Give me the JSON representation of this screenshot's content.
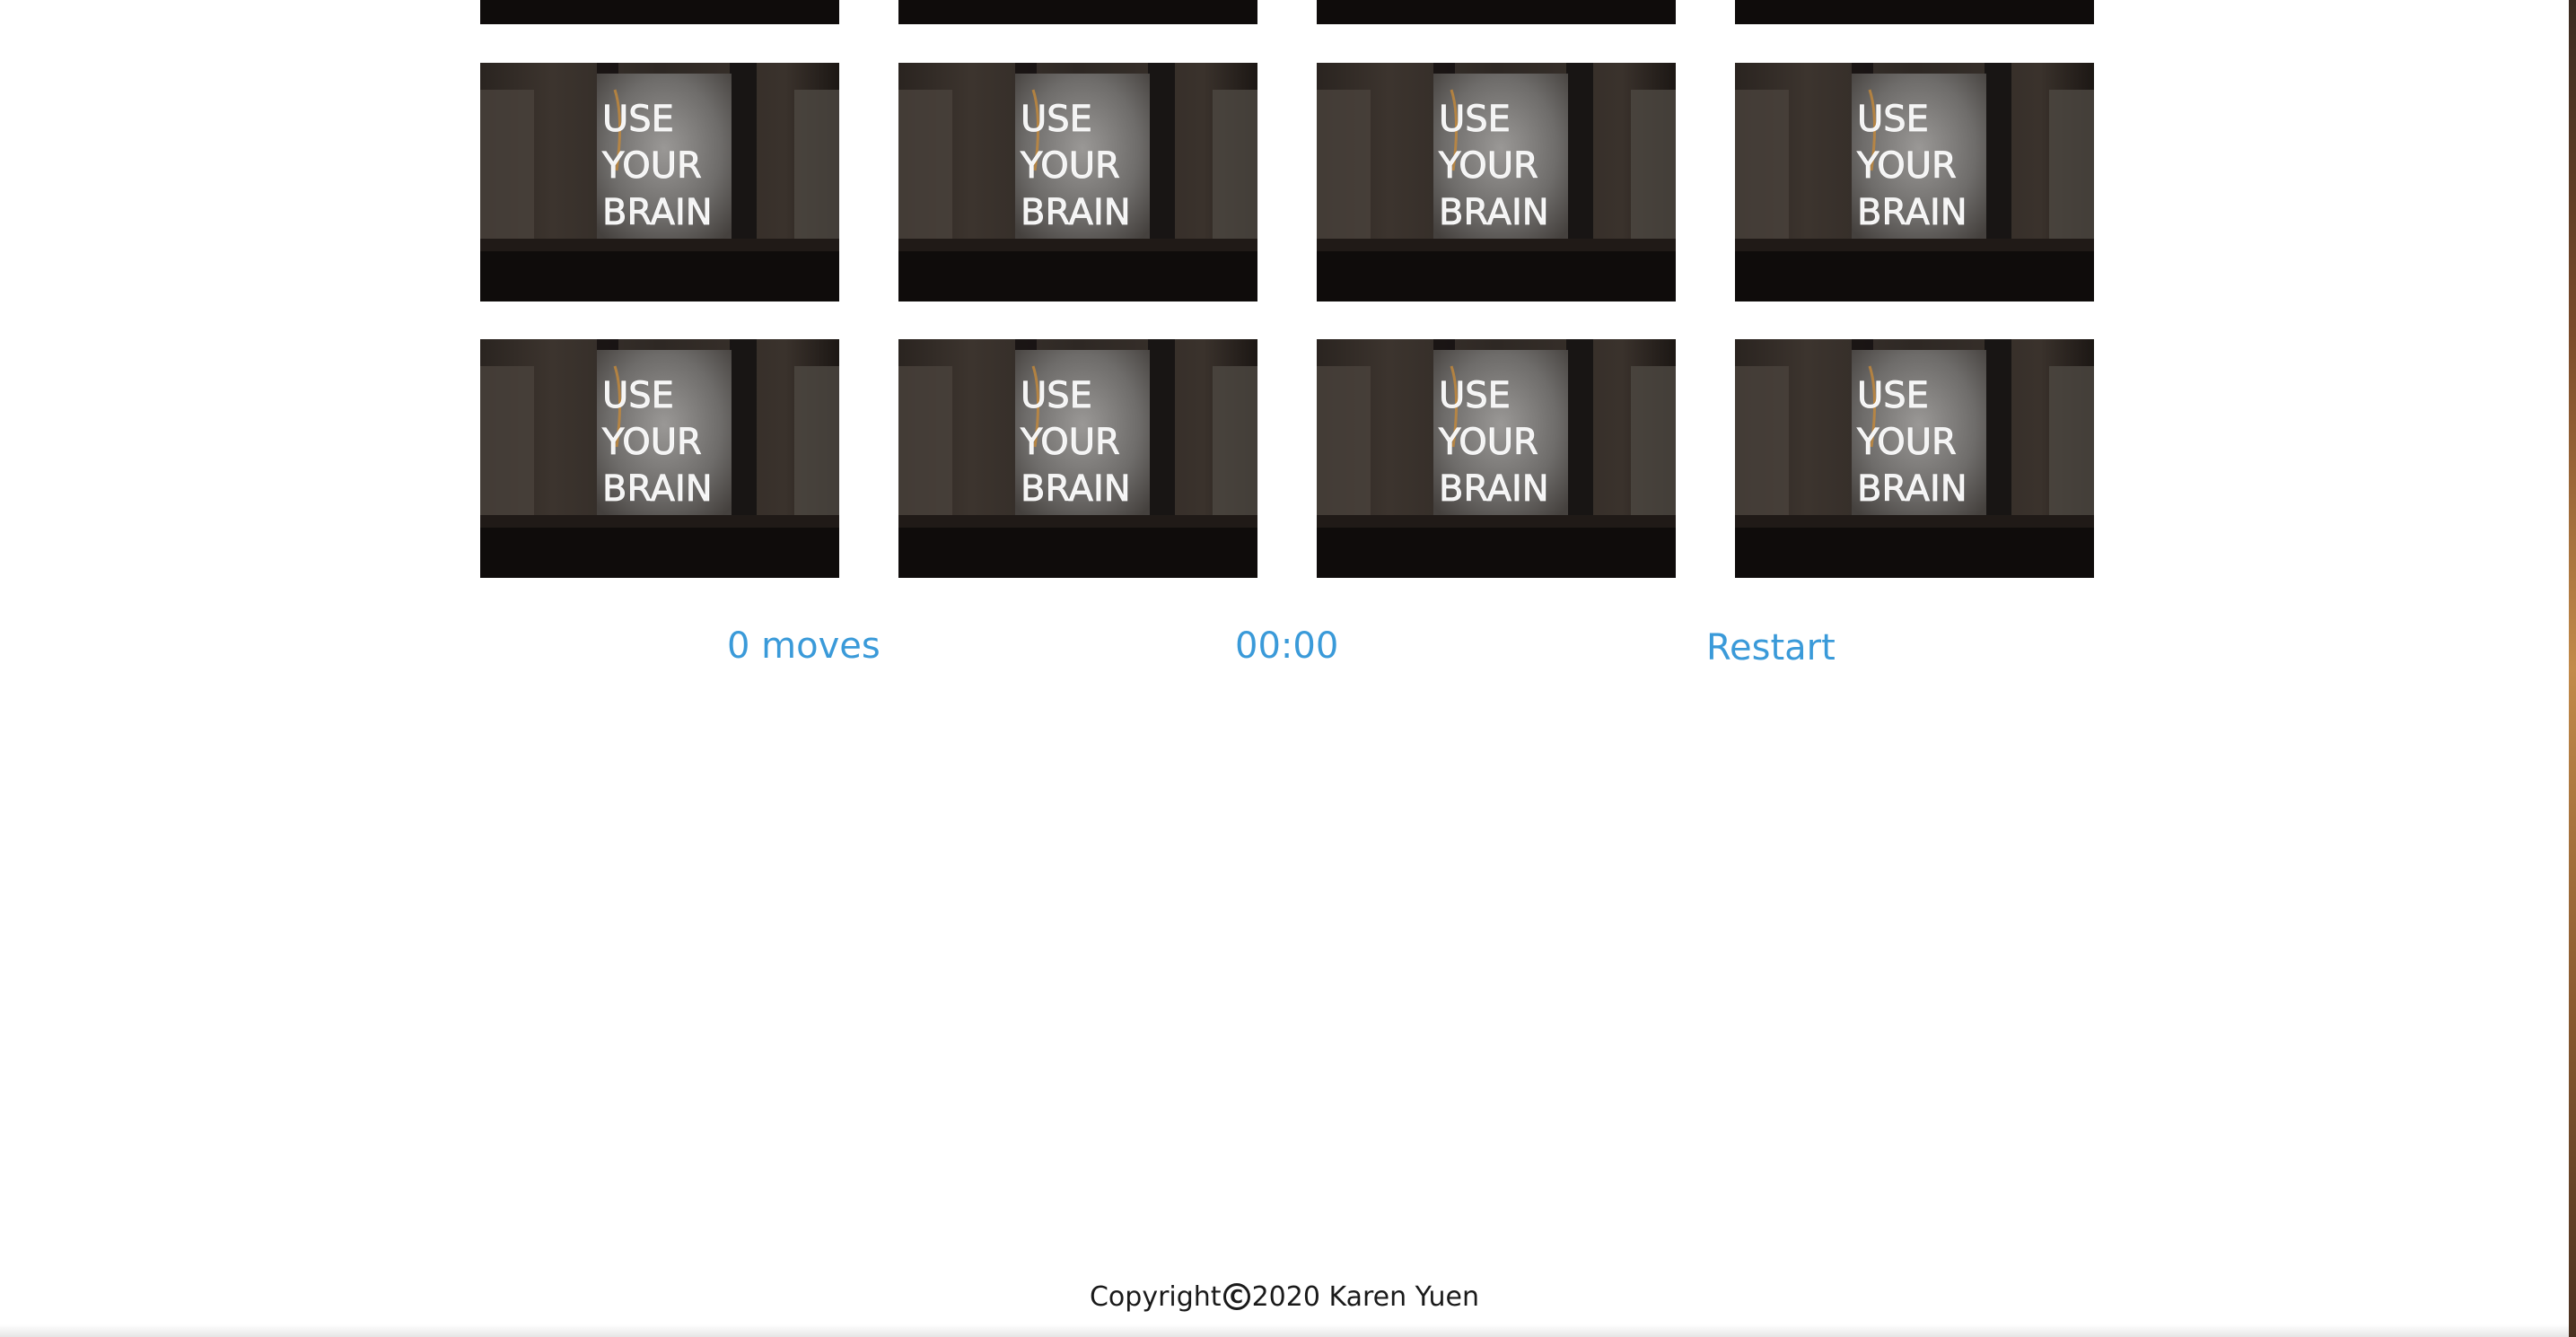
{
  "game": {
    "card_back_text": [
      "USE",
      "YOUR",
      "BRAIN"
    ],
    "cards_visible": 12
  },
  "stats": {
    "moves_label": "0 moves",
    "timer_label": "00:00",
    "restart_label": "Restart"
  },
  "footer": {
    "prefix": "Copyright",
    "symbol": "C",
    "suffix": "2020 Karen Yuen"
  },
  "colors": {
    "accent": "#3a9ad9",
    "footer_text": "#1a1a1a",
    "background": "#ffffff"
  }
}
